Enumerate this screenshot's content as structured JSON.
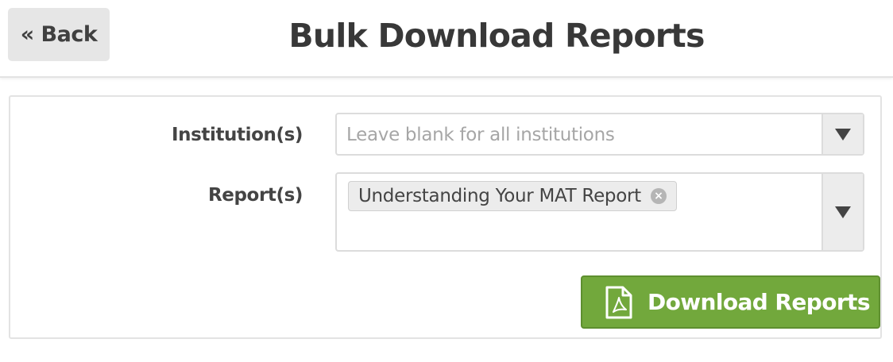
{
  "header": {
    "back_label": "« Back",
    "title": "Bulk Download Reports"
  },
  "form": {
    "institutions": {
      "label": "Institution(s)",
      "placeholder": "Leave blank for all institutions",
      "arrow_icon": "triangle-down-icon"
    },
    "reports": {
      "label": "Report(s)",
      "selected": [
        "Understanding Your MAT Report"
      ],
      "remove_icon": "close-circle-icon",
      "arrow_icon": "triangle-down-icon"
    }
  },
  "actions": {
    "download_label": "Download Reports",
    "download_icon": "pdf-file-icon",
    "download_color": "#72a83c"
  }
}
